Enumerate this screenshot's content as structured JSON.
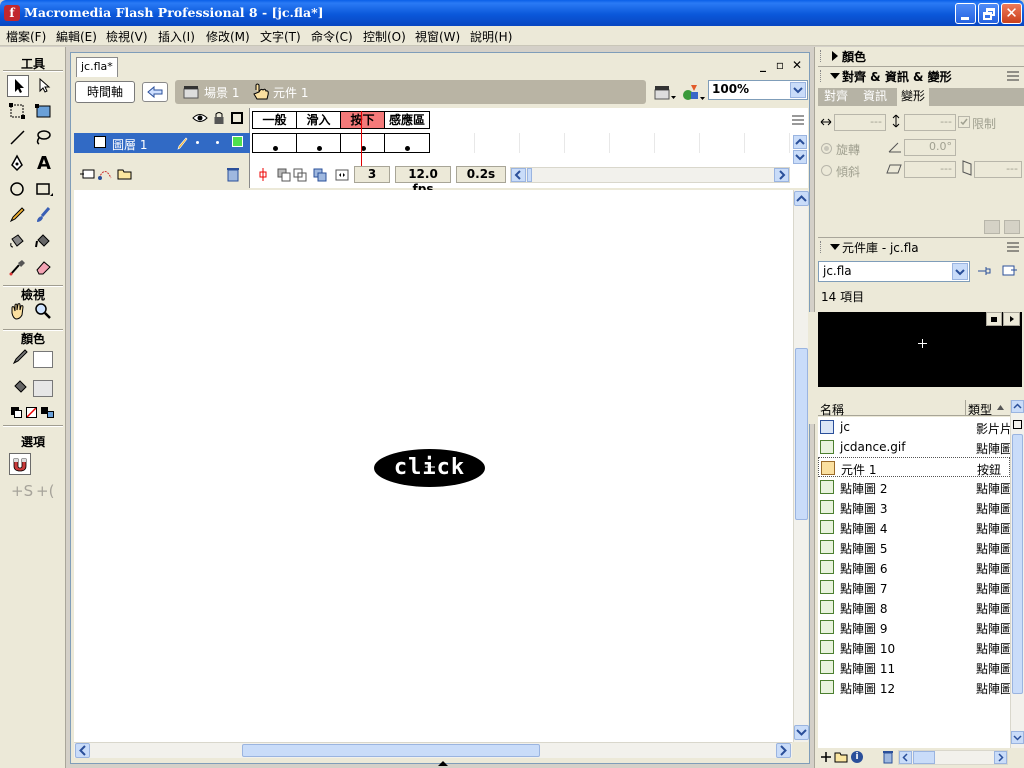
{
  "window": {
    "title": "Macromedia Flash Professional 8 - [jc.fla*]"
  },
  "menubar": [
    "檔案(F)",
    "編輯(E)",
    "檢視(V)",
    "插入(I)",
    "修改(M)",
    "文字(T)",
    "命令(C)",
    "控制(O)",
    "視窗(W)",
    "說明(H)"
  ],
  "tools": {
    "heading": "工具",
    "view_heading": "檢視",
    "colors_heading": "顏色",
    "options_heading": "選項",
    "items": [
      "selection-tool",
      "subselection-tool",
      "free-transform-tool",
      "fill-transform-tool",
      "line-tool",
      "lasso-tool",
      "pen-tool",
      "text-tool",
      "oval-tool",
      "rectangle-tool",
      "pencil-tool",
      "brush-tool",
      "ink-bottle-tool",
      "paint-bucket-tool",
      "eyedropper-tool",
      "eraser-tool",
      "hand-tool",
      "zoom-tool"
    ]
  },
  "document": {
    "tab": "jc.fla*",
    "timeline_button": "時間軸",
    "breadcrumb": [
      "場景 1",
      "元件 1"
    ],
    "zoom": "100%"
  },
  "timeline": {
    "layer": "圖層 1",
    "frame_labels": [
      "一般",
      "滑入",
      "按下",
      "感應區"
    ],
    "active_frame_index": 2,
    "current_frame": "3",
    "fps": "12.0 fps",
    "elapsed": "0.2s"
  },
  "stage": {
    "button_text": "click"
  },
  "panels": {
    "color": "顏色",
    "align_transform": "對齊 & 資訊 & 變形",
    "tabs": [
      "對齊",
      "資訊",
      "變形"
    ],
    "active_tab": 2,
    "transform": {
      "constrain": "限制",
      "rotate": "旋轉",
      "rotate_value": "0.0°",
      "skew": "傾斜",
      "width_value": "---",
      "height_value": "---",
      "skew_h_value": "---",
      "skew_v_value": "---"
    },
    "library": {
      "title": "元件庫 - jc.fla",
      "selected_file": "jc.fla",
      "count": "14 項目",
      "col_name": "名稱",
      "col_type": "類型",
      "items": [
        {
          "name": "jc",
          "type": "影片片段",
          "icon": "movieclip-icon"
        },
        {
          "name": "jcdance.gif",
          "type": "點陣圖",
          "icon": "bitmap-icon"
        },
        {
          "name": "元件 1",
          "type": "按鈕",
          "icon": "button-icon"
        },
        {
          "name": "點陣圖 2",
          "type": "點陣圖",
          "icon": "bitmap-icon"
        },
        {
          "name": "點陣圖 3",
          "type": "點陣圖",
          "icon": "bitmap-icon"
        },
        {
          "name": "點陣圖 4",
          "type": "點陣圖",
          "icon": "bitmap-icon"
        },
        {
          "name": "點陣圖 5",
          "type": "點陣圖",
          "icon": "bitmap-icon"
        },
        {
          "name": "點陣圖 6",
          "type": "點陣圖",
          "icon": "bitmap-icon"
        },
        {
          "name": "點陣圖 7",
          "type": "點陣圖",
          "icon": "bitmap-icon"
        },
        {
          "name": "點陣圖 8",
          "type": "點陣圖",
          "icon": "bitmap-icon"
        },
        {
          "name": "點陣圖 9",
          "type": "點陣圖",
          "icon": "bitmap-icon"
        },
        {
          "name": "點陣圖 10",
          "type": "點陣圖",
          "icon": "bitmap-icon"
        },
        {
          "name": "點陣圖 11",
          "type": "點陣圖",
          "icon": "bitmap-icon"
        },
        {
          "name": "點陣圖 12",
          "type": "點陣圖",
          "icon": "bitmap-icon"
        }
      ]
    }
  },
  "colors": {
    "titlebar": "#0b58da",
    "selection": "#316ac5",
    "active_frame": "#f47a7a",
    "playhead": "#e00000",
    "stage_bg": "#ffffff",
    "button_fill": "#000000"
  }
}
